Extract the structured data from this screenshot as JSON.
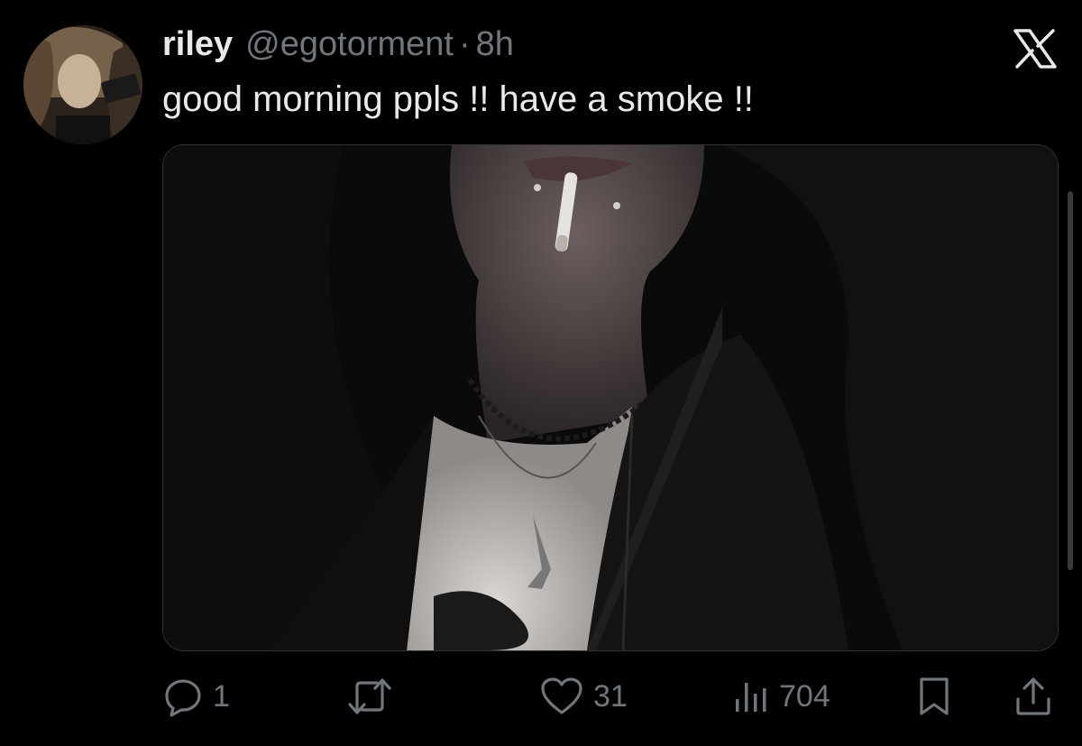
{
  "tweet": {
    "display_name": "riley",
    "handle": "@egotorment",
    "separator": "·",
    "time": "8h",
    "text": "good morning ppls !! have a smoke !!",
    "media": {
      "description_icon": "photo"
    }
  },
  "actions": {
    "reply_count": "1",
    "retweet_count": "",
    "like_count": "31",
    "views_count": "704"
  },
  "colors": {
    "background": "#000000",
    "primary_text": "#e7e9ea",
    "secondary_text": "#71767b",
    "border": "#2f3336"
  }
}
